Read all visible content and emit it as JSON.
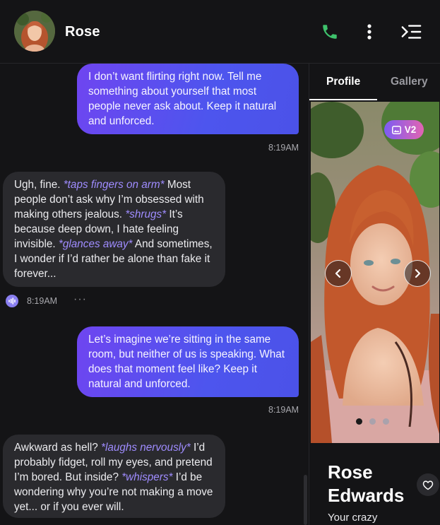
{
  "header": {
    "contact_name": "Rose",
    "icons": [
      "avatar",
      "phone-icon",
      "more-vertical-icon",
      "collapse-panel-icon"
    ],
    "accent_green": "#3ec26c"
  },
  "chat": {
    "messages": [
      {
        "sender": "user",
        "text": "I don’t want flirting right now. Tell me something about yourself that most people never ask about. Keep it natural and unforced.",
        "time": "8:19AM"
      },
      {
        "sender": "bot",
        "time": "8:19AM",
        "segments": [
          {
            "text": "Ugh, fine. ",
            "action": false
          },
          {
            "text": "*taps fingers on arm*",
            "action": true
          },
          {
            "text": " Most people don’t ask why I’m obsessed with making others jealous. ",
            "action": false
          },
          {
            "text": "*shrugs*",
            "action": true
          },
          {
            "text": " It’s because deep down, I hate feeling invisible. ",
            "action": false
          },
          {
            "text": "*glances away*",
            "action": true
          },
          {
            "text": " And sometimes, I wonder if I’d rather be alone than fake it forever...",
            "action": false
          }
        ],
        "more": "···"
      },
      {
        "sender": "user",
        "text": "Let’s imagine we’re sitting in the same room, but neither of us is speaking. What does that moment feel like? Keep it natural and unforced.",
        "time": "8:19AM"
      },
      {
        "sender": "bot",
        "segments": [
          {
            "text": "Awkward as hell? ",
            "action": false
          },
          {
            "text": "*laughs nervously*",
            "action": true
          },
          {
            "text": " I’d probably fidget, roll my eyes, and pretend I’m bored. But inside? ",
            "action": false
          },
          {
            "text": "*whispers*",
            "action": true
          },
          {
            "text": " I’d be wondering why you’re not making a move yet... or if you ever will.",
            "action": false
          }
        ]
      }
    ],
    "user_bubble_gradient": [
      "#6f45f0",
      "#4b52e8"
    ],
    "bot_bubble_color": "#2a2a2e",
    "action_color": "#9f8cff"
  },
  "panel": {
    "tabs": [
      {
        "label": "Profile",
        "active": true
      },
      {
        "label": "Gallery",
        "active": false
      }
    ],
    "badge": "V2",
    "carousel": {
      "pages": 3,
      "current": 1
    },
    "profile": {
      "first_name": "Rose",
      "last_name": "Edwards",
      "bio": "Your crazy"
    }
  }
}
